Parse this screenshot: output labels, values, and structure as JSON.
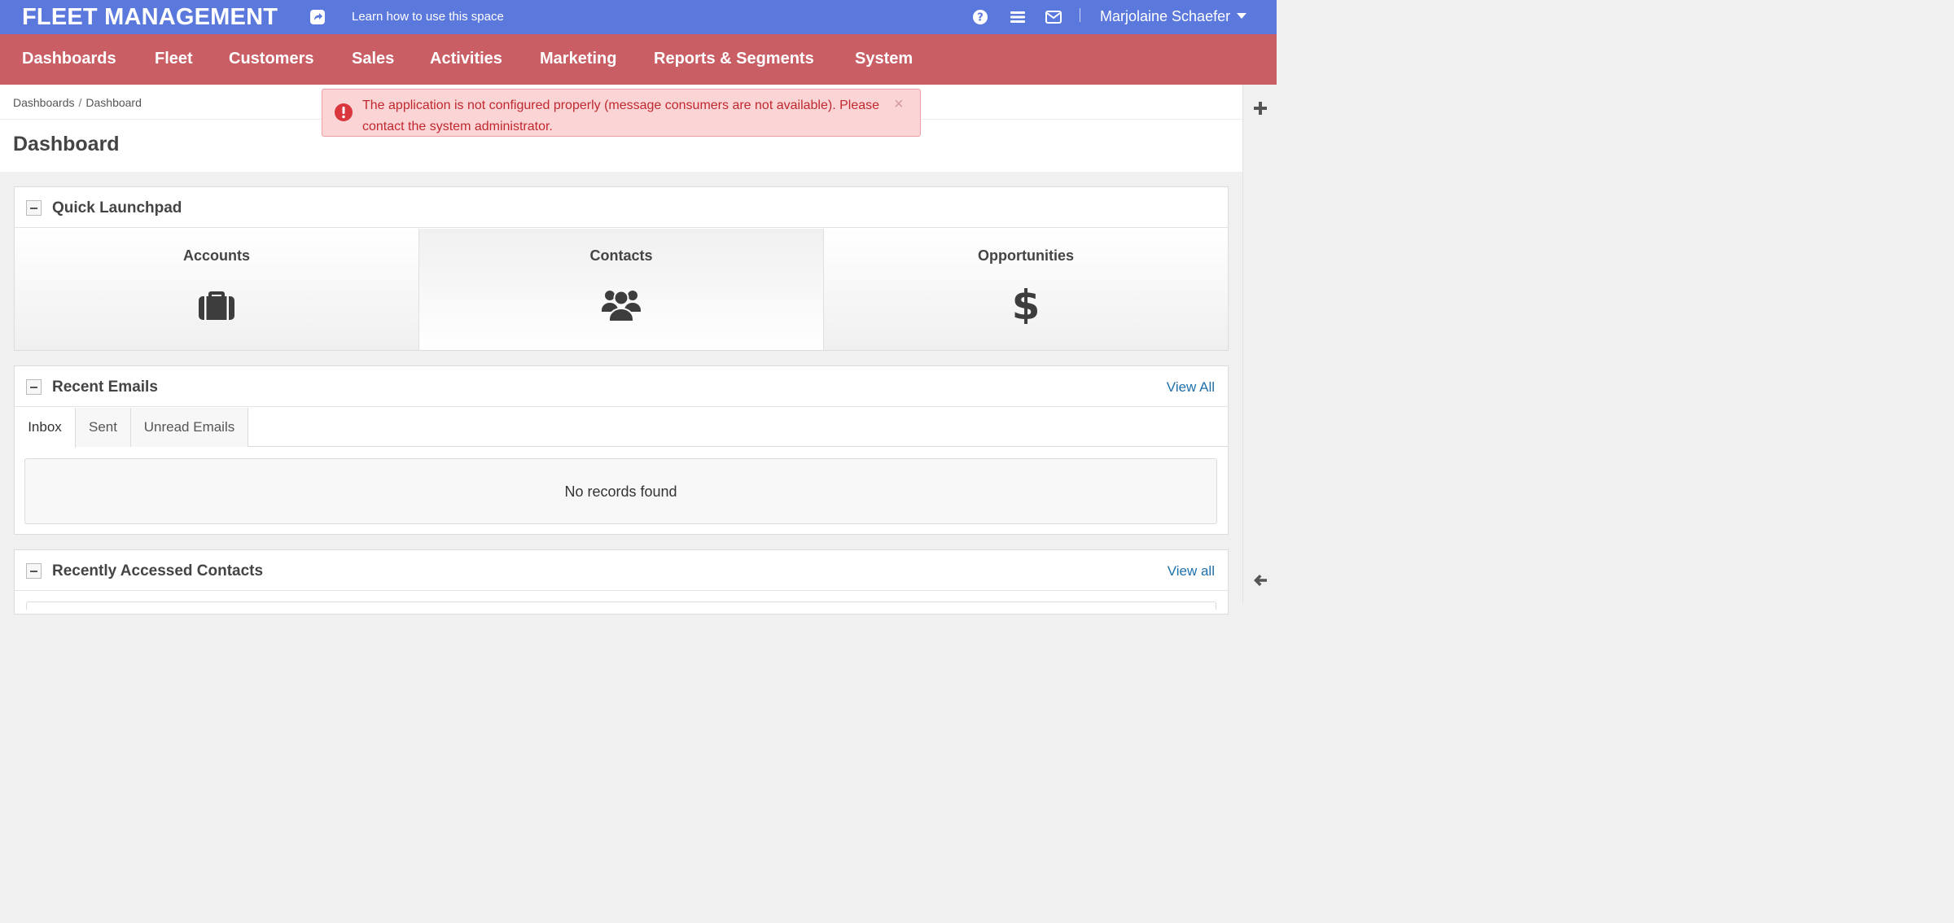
{
  "topbar": {
    "brand": "FLEET MANAGEMENT",
    "learn_link": "Learn how to use this space",
    "user_name": "Marjolaine Schaefer",
    "icons": [
      "share-icon",
      "help-icon",
      "menu-icon",
      "mail-icon"
    ],
    "background_color": "#5b78dd"
  },
  "mainnav": {
    "background_color": "#c95e65",
    "items": [
      {
        "label": "Dashboards"
      },
      {
        "label": "Fleet"
      },
      {
        "label": "Customers"
      },
      {
        "label": "Sales"
      },
      {
        "label": "Activities"
      },
      {
        "label": "Marketing"
      },
      {
        "label": "Reports & Segments"
      },
      {
        "label": "System"
      }
    ]
  },
  "breadcrumb": {
    "items": [
      "Dashboards",
      "Dashboard"
    ],
    "separator": "/"
  },
  "page": {
    "title": "Dashboard"
  },
  "alert": {
    "message": "The application is not configured properly (message consumers are not available). Please contact the system administrator.",
    "close_symbol": "×",
    "type": "error"
  },
  "quick_launchpad": {
    "title": "Quick Launchpad",
    "tiles": [
      {
        "label": "Accounts",
        "icon": "briefcase-icon"
      },
      {
        "label": "Contacts",
        "icon": "users-icon"
      },
      {
        "label": "Opportunities",
        "icon": "dollar-icon"
      }
    ]
  },
  "recent_emails": {
    "title": "Recent Emails",
    "view_all": "View All",
    "tabs": [
      {
        "label": "Inbox",
        "active": true
      },
      {
        "label": "Sent",
        "active": false
      },
      {
        "label": "Unread Emails",
        "active": false
      }
    ],
    "empty_message": "No records found"
  },
  "recent_contacts": {
    "title": "Recently Accessed Contacts",
    "view_all": "View all"
  },
  "side_strip": {
    "icons": [
      "plus-icon",
      "arrow-left-icon"
    ]
  }
}
